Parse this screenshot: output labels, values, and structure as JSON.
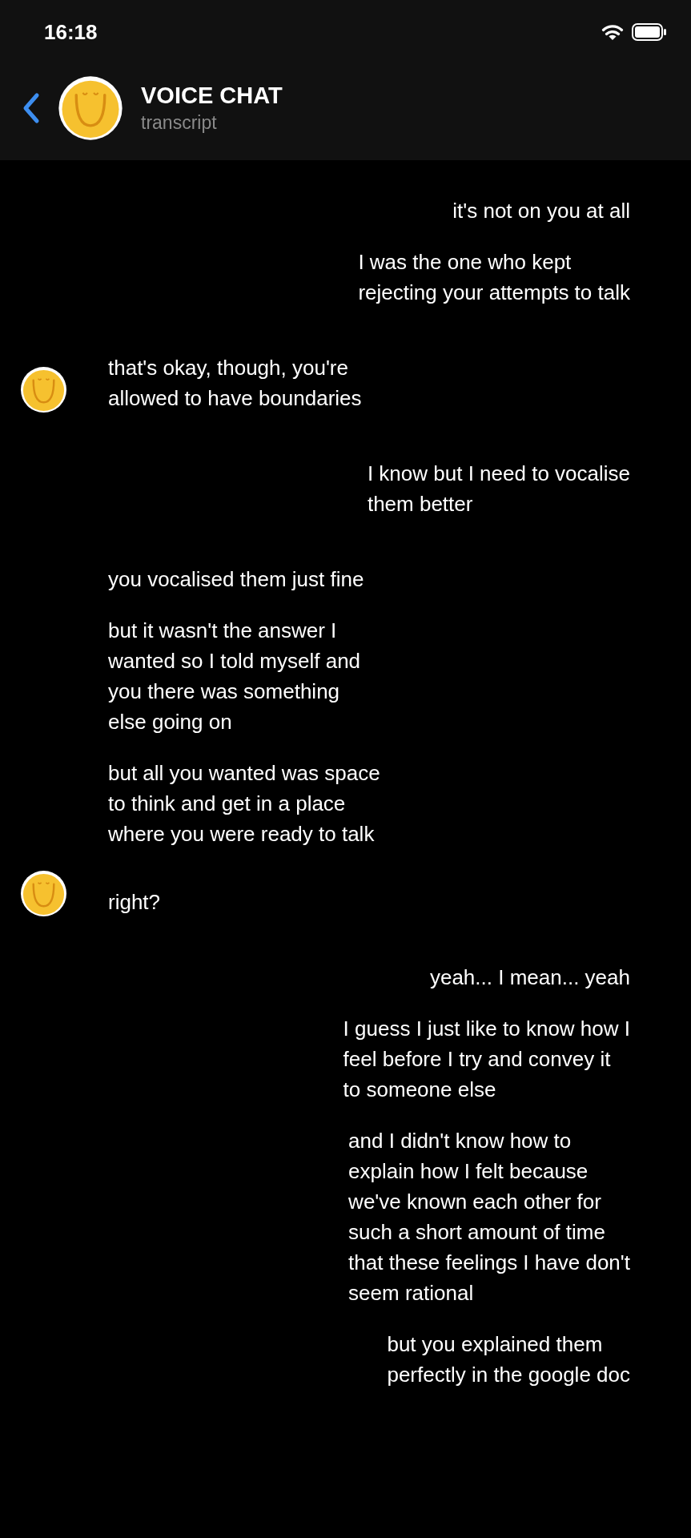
{
  "status_bar": {
    "time": "16:18"
  },
  "header": {
    "title": "VOICE CHAT",
    "subtitle": "transcript"
  },
  "messages": [
    {
      "kind": "outgoing",
      "text": "it's not on you at all"
    },
    {
      "kind": "outgoing",
      "text": "I was the one who kept\nrejecting your attempts to talk"
    },
    {
      "kind": "incoming",
      "text": "that's okay, though, you're\nallowed to have boundaries"
    },
    {
      "kind": "outgoing",
      "text": "I know but I need to vocalise\nthem better"
    },
    {
      "kind": "incoming",
      "text": "you vocalised them just fine"
    },
    {
      "kind": "incoming",
      "text": "but it wasn't the answer I\nwanted so I told myself and\nyou there was something\nelse going on"
    },
    {
      "kind": "incoming",
      "text": "but all you wanted was space\nto think and get in a place\nwhere you were ready to talk"
    },
    {
      "kind": "incoming",
      "text": "right?"
    },
    {
      "kind": "outgoing",
      "text": "yeah... I mean... yeah"
    },
    {
      "kind": "outgoing",
      "text": "I guess I just like to know how I\nfeel before I try and convey it\nto someone else"
    },
    {
      "kind": "outgoing",
      "text": "and I didn't know how to\nexplain how I felt because\nwe've known each other for\nsuch a short amount of time\nthat these feelings I have don't\nseem rational"
    },
    {
      "kind": "outgoing",
      "text": "but you explained them\nperfectly in the google doc"
    }
  ]
}
